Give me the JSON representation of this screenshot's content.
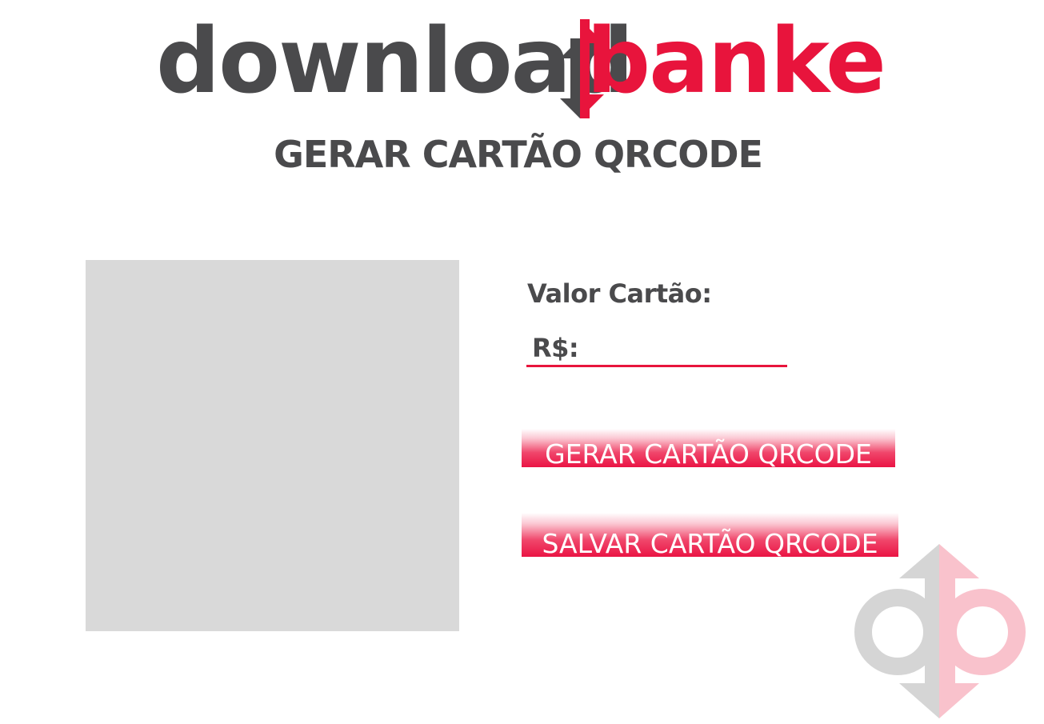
{
  "brand": {
    "logo_text_left": "download",
    "logo_text_right": "banker",
    "colors": {
      "dark": "#4a4a4c",
      "accent": "#e8143c",
      "watermark_gray": "#d5d5d5",
      "watermark_pink": "#f9c2cc"
    }
  },
  "header": {
    "title": "GERAR CARTÃO QRCODE"
  },
  "form": {
    "value_label": "Valor Cartão:",
    "currency_prefix": "R$:",
    "value_input": ""
  },
  "buttons": {
    "generate_label": "GERAR CARTÃO QRCODE",
    "save_label": "SALVAR CARTÃO QRCODE"
  }
}
